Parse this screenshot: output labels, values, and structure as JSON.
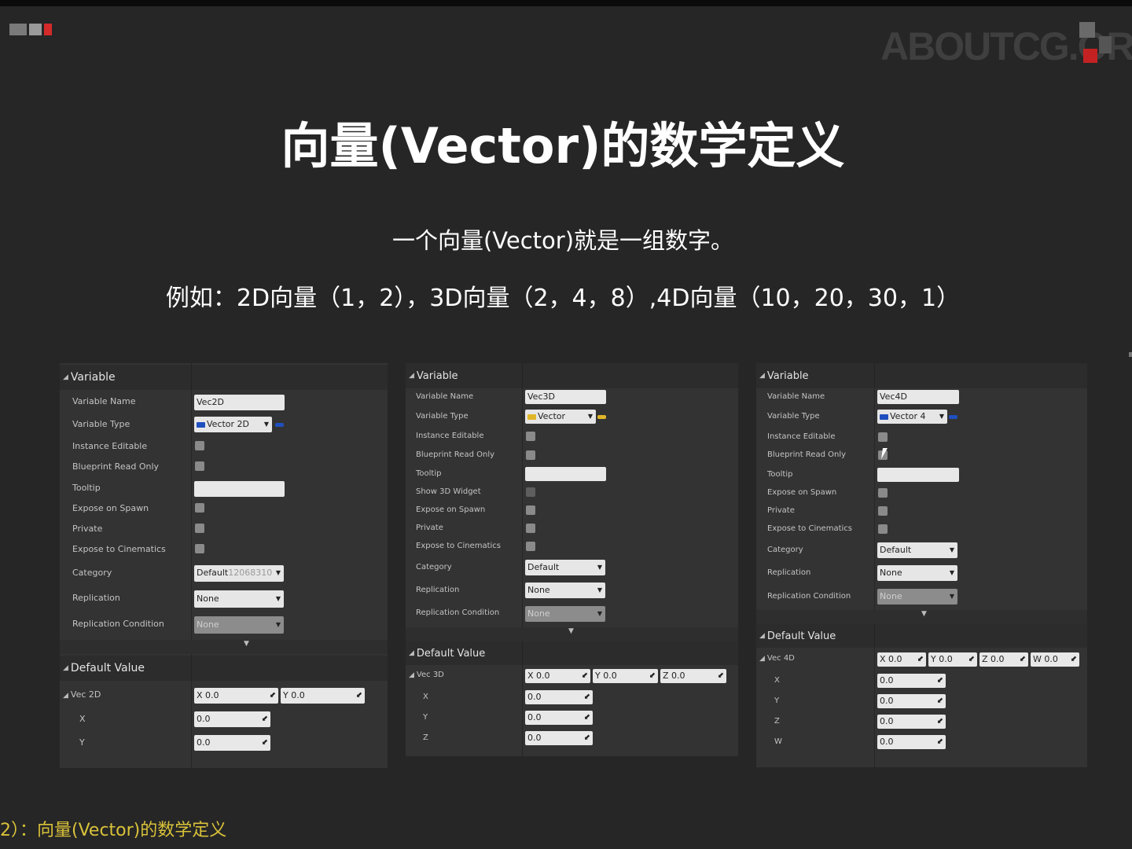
{
  "title": "向量(Vector)的数学定义",
  "subtitle": "一个向量(Vector)就是一组数字。",
  "example": "例如：2D向量（1，2），3D向量（2，4，8）,4D向量（10，20，30，1）",
  "caption": "2）：向量(Vector)的数学定义",
  "logo": "ABOUTCG.ORG",
  "colors": {
    "background": "#262626",
    "panel": "#333333",
    "caption": "#d9c23a",
    "vector2d_pin": "#1f4fbf",
    "vector_pin": "#e0b62a"
  },
  "panels": [
    {
      "variable_header": "Variable",
      "labels": [
        "Variable Name",
        "Variable Type",
        "Instance Editable",
        "Blueprint Read Only",
        "Tooltip",
        "Expose on Spawn",
        "Private",
        "Expose to Cinematics",
        "Category",
        "Replication",
        "Replication Condition"
      ],
      "name_value": "Vec2D",
      "type_value": "Vector 2D",
      "category_value": "Default",
      "category_hint": "12068310",
      "replication_value": "None",
      "rep_condition_value": "None",
      "default_header": "Default Value",
      "vec_label": "Vec 2D",
      "vec_fields": [
        "X  0.0",
        "Y  0.0"
      ],
      "comp_labels": [
        "X",
        "Y"
      ],
      "comp_values": [
        "0.0",
        "0.0"
      ]
    },
    {
      "variable_header": "Variable",
      "labels": [
        "Variable Name",
        "Variable Type",
        "Instance Editable",
        "Blueprint Read Only",
        "Tooltip",
        "Show 3D Widget",
        "Expose on Spawn",
        "Private",
        "Expose to Cinematics",
        "Category",
        "Replication",
        "Replication Condition"
      ],
      "name_value": "Vec3D",
      "type_value": "Vector",
      "category_value": "Default",
      "replication_value": "None",
      "rep_condition_value": "None",
      "default_header": "Default Value",
      "vec_label": "Vec 3D",
      "vec_fields": [
        "X  0.0",
        "Y  0.0",
        "Z  0.0"
      ],
      "comp_labels": [
        "X",
        "Y",
        "Z"
      ],
      "comp_values": [
        "0.0",
        "0.0",
        "0.0"
      ]
    },
    {
      "variable_header": "Variable",
      "labels": [
        "Variable Name",
        "Variable Type",
        "Instance Editable",
        "Blueprint Read Only",
        "Tooltip",
        "Expose on Spawn",
        "Private",
        "Expose to Cinematics",
        "Category",
        "Replication",
        "Replication Condition"
      ],
      "name_value": "Vec4D",
      "type_value": "Vector 4",
      "category_value": "Default",
      "replication_value": "None",
      "rep_condition_value": "None",
      "default_header": "Default Value",
      "vec_label": "Vec 4D",
      "vec_fields": [
        "X  0.0",
        "Y  0.0",
        "Z  0.0",
        "W  0.0"
      ],
      "comp_labels": [
        "X",
        "Y",
        "Z",
        "W"
      ],
      "comp_values": [
        "0.0",
        "0.0",
        "0.0",
        "0.0"
      ]
    }
  ]
}
